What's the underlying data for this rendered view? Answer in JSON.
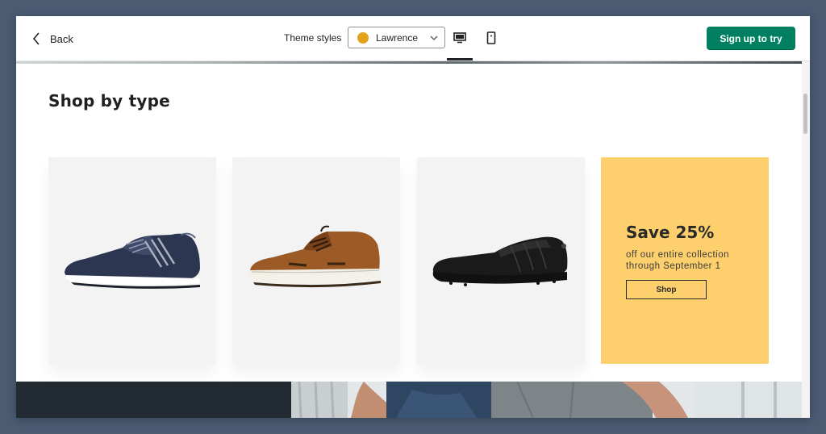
{
  "topbar": {
    "back_label": "Back",
    "theme_label": "Theme styles",
    "theme_value": "Lawrence",
    "signup_label": "Sign up to try"
  },
  "section": {
    "title": "Shop by type"
  },
  "products": [
    {
      "name": "navy-sneaker"
    },
    {
      "name": "brown-sneaker"
    },
    {
      "name": "black-slip-on"
    }
  ],
  "promo": {
    "title": "Save 25%",
    "text": "off our entire collection through September 1",
    "button": "Shop"
  },
  "colors": {
    "accent": "#008060",
    "promo_bg": "#fdd06d",
    "swatch": "#e3a21a",
    "frame": "#4a5b72"
  },
  "icons": [
    "chevron-left-icon",
    "chevron-down-icon",
    "desktop-icon",
    "mobile-icon"
  ]
}
